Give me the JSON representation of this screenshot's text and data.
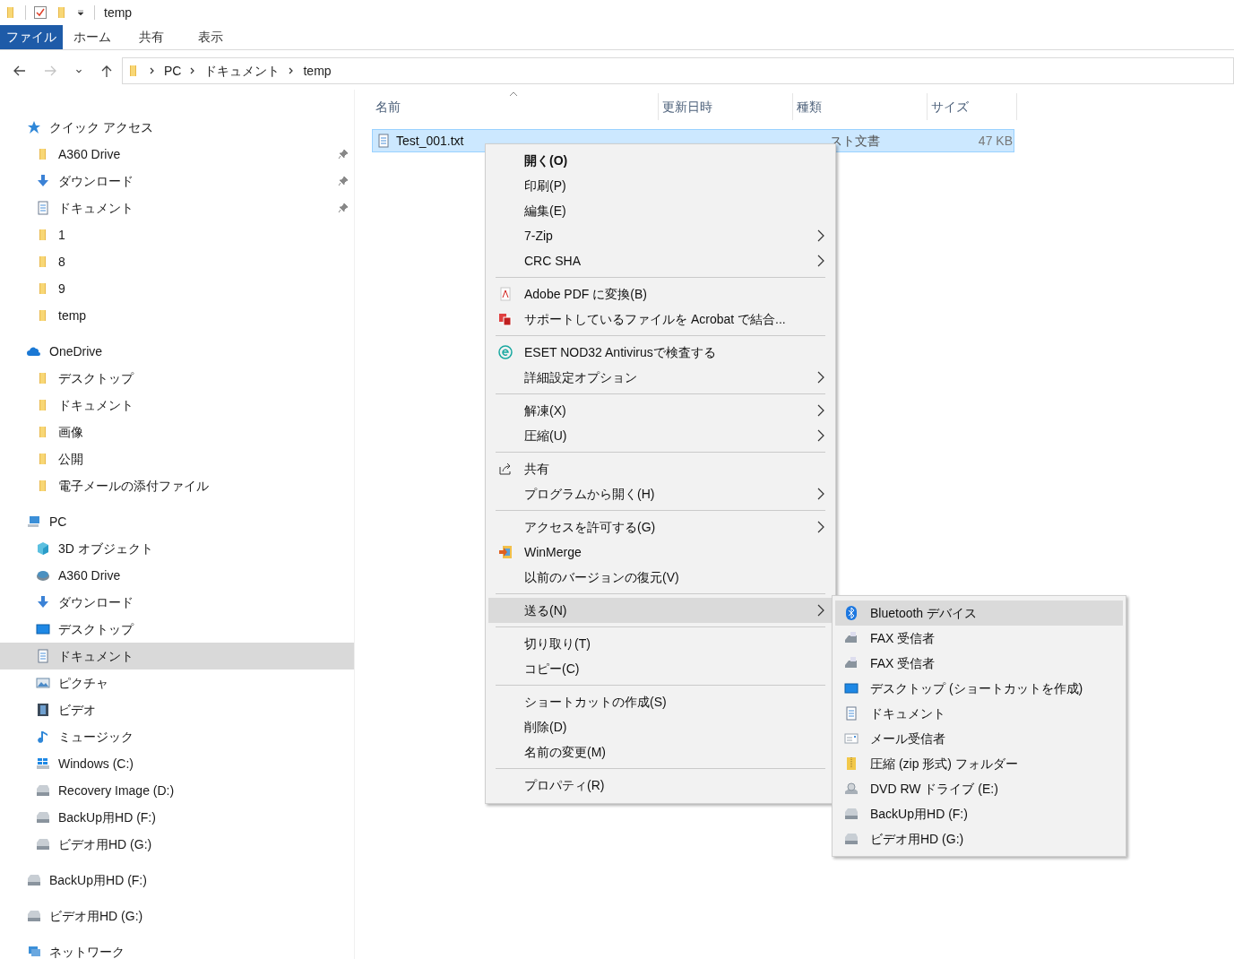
{
  "window": {
    "title": "temp"
  },
  "ribbon_tabs": [
    {
      "label": "ファイル",
      "selected": true
    },
    {
      "label": "ホーム",
      "selected": false
    },
    {
      "label": "共有",
      "selected": false
    },
    {
      "label": "表示",
      "selected": false
    }
  ],
  "nav_buttons": [
    {
      "kind": "back",
      "disabled": false
    },
    {
      "kind": "forward",
      "disabled": true
    },
    {
      "kind": "recent",
      "disabled": false
    },
    {
      "kind": "up",
      "disabled": false
    }
  ],
  "address": {
    "breadcrumbs": [
      "PC",
      "ドキュメント",
      "temp"
    ]
  },
  "sidebar": {
    "items": [
      {
        "label": "クイック アクセス",
        "kind": "star",
        "selected": false,
        "children": [
          {
            "label": "A360 Drive",
            "kind": "folder",
            "pinned": true,
            "selected": false
          },
          {
            "label": "ダウンロード",
            "kind": "download",
            "pinned": true,
            "selected": false
          },
          {
            "label": "ドキュメント",
            "kind": "document",
            "pinned": true,
            "selected": false
          },
          {
            "label": "1",
            "kind": "folder",
            "selected": false
          },
          {
            "label": "8",
            "kind": "folder",
            "selected": false
          },
          {
            "label": "9",
            "kind": "folder",
            "selected": false
          },
          {
            "label": "temp",
            "kind": "folder",
            "selected": false
          }
        ]
      },
      {
        "label": "OneDrive",
        "kind": "cloud",
        "selected": false,
        "children": [
          {
            "label": "デスクトップ",
            "kind": "folder",
            "selected": false
          },
          {
            "label": "ドキュメント",
            "kind": "folder",
            "selected": false
          },
          {
            "label": "画像",
            "kind": "folder",
            "selected": false
          },
          {
            "label": "公開",
            "kind": "folder",
            "selected": false
          },
          {
            "label": "電子メールの添付ファイル",
            "kind": "folder",
            "selected": false
          }
        ]
      },
      {
        "label": "PC",
        "kind": "pc",
        "selected": false,
        "children": [
          {
            "label": "3D オブジェクト",
            "kind": "cube",
            "selected": false
          },
          {
            "label": "A360 Drive",
            "kind": "disc",
            "selected": false
          },
          {
            "label": "ダウンロード",
            "kind": "download",
            "selected": false
          },
          {
            "label": "デスクトップ",
            "kind": "desktop",
            "selected": false
          },
          {
            "label": "ドキュメント",
            "kind": "document",
            "selected": true
          },
          {
            "label": "ピクチャ",
            "kind": "pictures",
            "selected": false
          },
          {
            "label": "ビデオ",
            "kind": "video",
            "selected": false
          },
          {
            "label": "ミュージック",
            "kind": "music",
            "selected": false
          },
          {
            "label": "Windows (C:)",
            "kind": "windows",
            "selected": false
          },
          {
            "label": "Recovery Image (D:)",
            "kind": "drive",
            "selected": false
          },
          {
            "label": "BackUp用HD (F:)",
            "kind": "drive",
            "selected": false
          },
          {
            "label": "ビデオ用HD (G:)",
            "kind": "drive",
            "selected": false
          }
        ]
      },
      {
        "label": "BackUp用HD (F:)",
        "kind": "drive",
        "selected": false
      },
      {
        "label": "ビデオ用HD (G:)",
        "kind": "drive",
        "selected": false
      },
      {
        "label": "ネットワーク",
        "kind": "network",
        "selected": false
      }
    ]
  },
  "file_list": {
    "columns": [
      {
        "label": "名前",
        "sorted": true
      },
      {
        "label": "更新日時"
      },
      {
        "label": "種類"
      },
      {
        "label": "サイズ"
      }
    ],
    "rows": [
      {
        "name": "Test_001.txt",
        "type": "スト文書",
        "size": "47 KB",
        "selected": true
      }
    ]
  },
  "context_menu": {
    "groups": [
      [
        {
          "label": "開く(O)",
          "bold": true,
          "submenu": false,
          "highlighted": false
        },
        {
          "label": "印刷(P)",
          "bold": false,
          "submenu": false,
          "highlighted": false
        },
        {
          "label": "編集(E)",
          "bold": false,
          "submenu": false,
          "highlighted": false
        },
        {
          "label": "7-Zip",
          "bold": false,
          "submenu": true,
          "highlighted": false
        },
        {
          "label": "CRC SHA",
          "bold": false,
          "submenu": true,
          "highlighted": false
        }
      ],
      [
        {
          "label": "Adobe PDF に変換(B)",
          "kind": "pdf",
          "bold": false,
          "submenu": false,
          "highlighted": false
        },
        {
          "label": "サポートしているファイルを Acrobat で結合...",
          "kind": "acrobat",
          "bold": false,
          "submenu": false,
          "highlighted": false
        }
      ],
      [
        {
          "label": "ESET NOD32 Antivirusで検査する",
          "kind": "eset",
          "bold": false,
          "submenu": false,
          "highlighted": false
        },
        {
          "label": "詳細設定オプション",
          "bold": false,
          "submenu": true,
          "highlighted": false
        }
      ],
      [
        {
          "label": "解凍(X)",
          "bold": false,
          "submenu": true,
          "highlighted": false
        },
        {
          "label": "圧縮(U)",
          "bold": false,
          "submenu": true,
          "highlighted": false
        }
      ],
      [
        {
          "label": "共有",
          "kind": "share",
          "bold": false,
          "submenu": false,
          "highlighted": false
        },
        {
          "label": "プログラムから開く(H)",
          "bold": false,
          "submenu": true,
          "highlighted": false
        }
      ],
      [
        {
          "label": "アクセスを許可する(G)",
          "bold": false,
          "submenu": true,
          "highlighted": false
        },
        {
          "label": "WinMerge",
          "kind": "winmerge",
          "bold": false,
          "submenu": false,
          "highlighted": false
        },
        {
          "label": "以前のバージョンの復元(V)",
          "bold": false,
          "submenu": false,
          "highlighted": false
        }
      ],
      [
        {
          "label": "送る(N)",
          "bold": false,
          "submenu": true,
          "highlighted": true
        }
      ],
      [
        {
          "label": "切り取り(T)",
          "bold": false,
          "submenu": false,
          "highlighted": false
        },
        {
          "label": "コピー(C)",
          "bold": false,
          "submenu": false,
          "highlighted": false
        }
      ],
      [
        {
          "label": "ショートカットの作成(S)",
          "bold": false,
          "submenu": false,
          "highlighted": false
        },
        {
          "label": "削除(D)",
          "bold": false,
          "submenu": false,
          "highlighted": false
        },
        {
          "label": "名前の変更(M)",
          "bold": false,
          "submenu": false,
          "highlighted": false
        }
      ],
      [
        {
          "label": "プロパティ(R)",
          "bold": false,
          "submenu": false,
          "highlighted": false
        }
      ]
    ]
  },
  "send_to_menu": {
    "items": [
      {
        "label": "Bluetooth デバイス",
        "kind": "bluetooth",
        "highlighted": true
      },
      {
        "label": "FAX 受信者",
        "kind": "fax",
        "highlighted": false
      },
      {
        "label": "FAX 受信者",
        "kind": "fax",
        "highlighted": false
      },
      {
        "label": "デスクトップ (ショートカットを作成)",
        "kind": "desktop",
        "highlighted": false
      },
      {
        "label": "ドキュメント",
        "kind": "document",
        "highlighted": false
      },
      {
        "label": "メール受信者",
        "kind": "mail",
        "highlighted": false
      },
      {
        "label": "圧縮 (zip 形式) フォルダー",
        "kind": "zip",
        "highlighted": false
      },
      {
        "label": "DVD RW ドライブ (E:)",
        "kind": "dvd",
        "highlighted": false
      },
      {
        "label": "BackUp用HD (F:)",
        "kind": "drive",
        "highlighted": false
      },
      {
        "label": "ビデオ用HD (G:)",
        "kind": "drive",
        "highlighted": false
      }
    ]
  }
}
